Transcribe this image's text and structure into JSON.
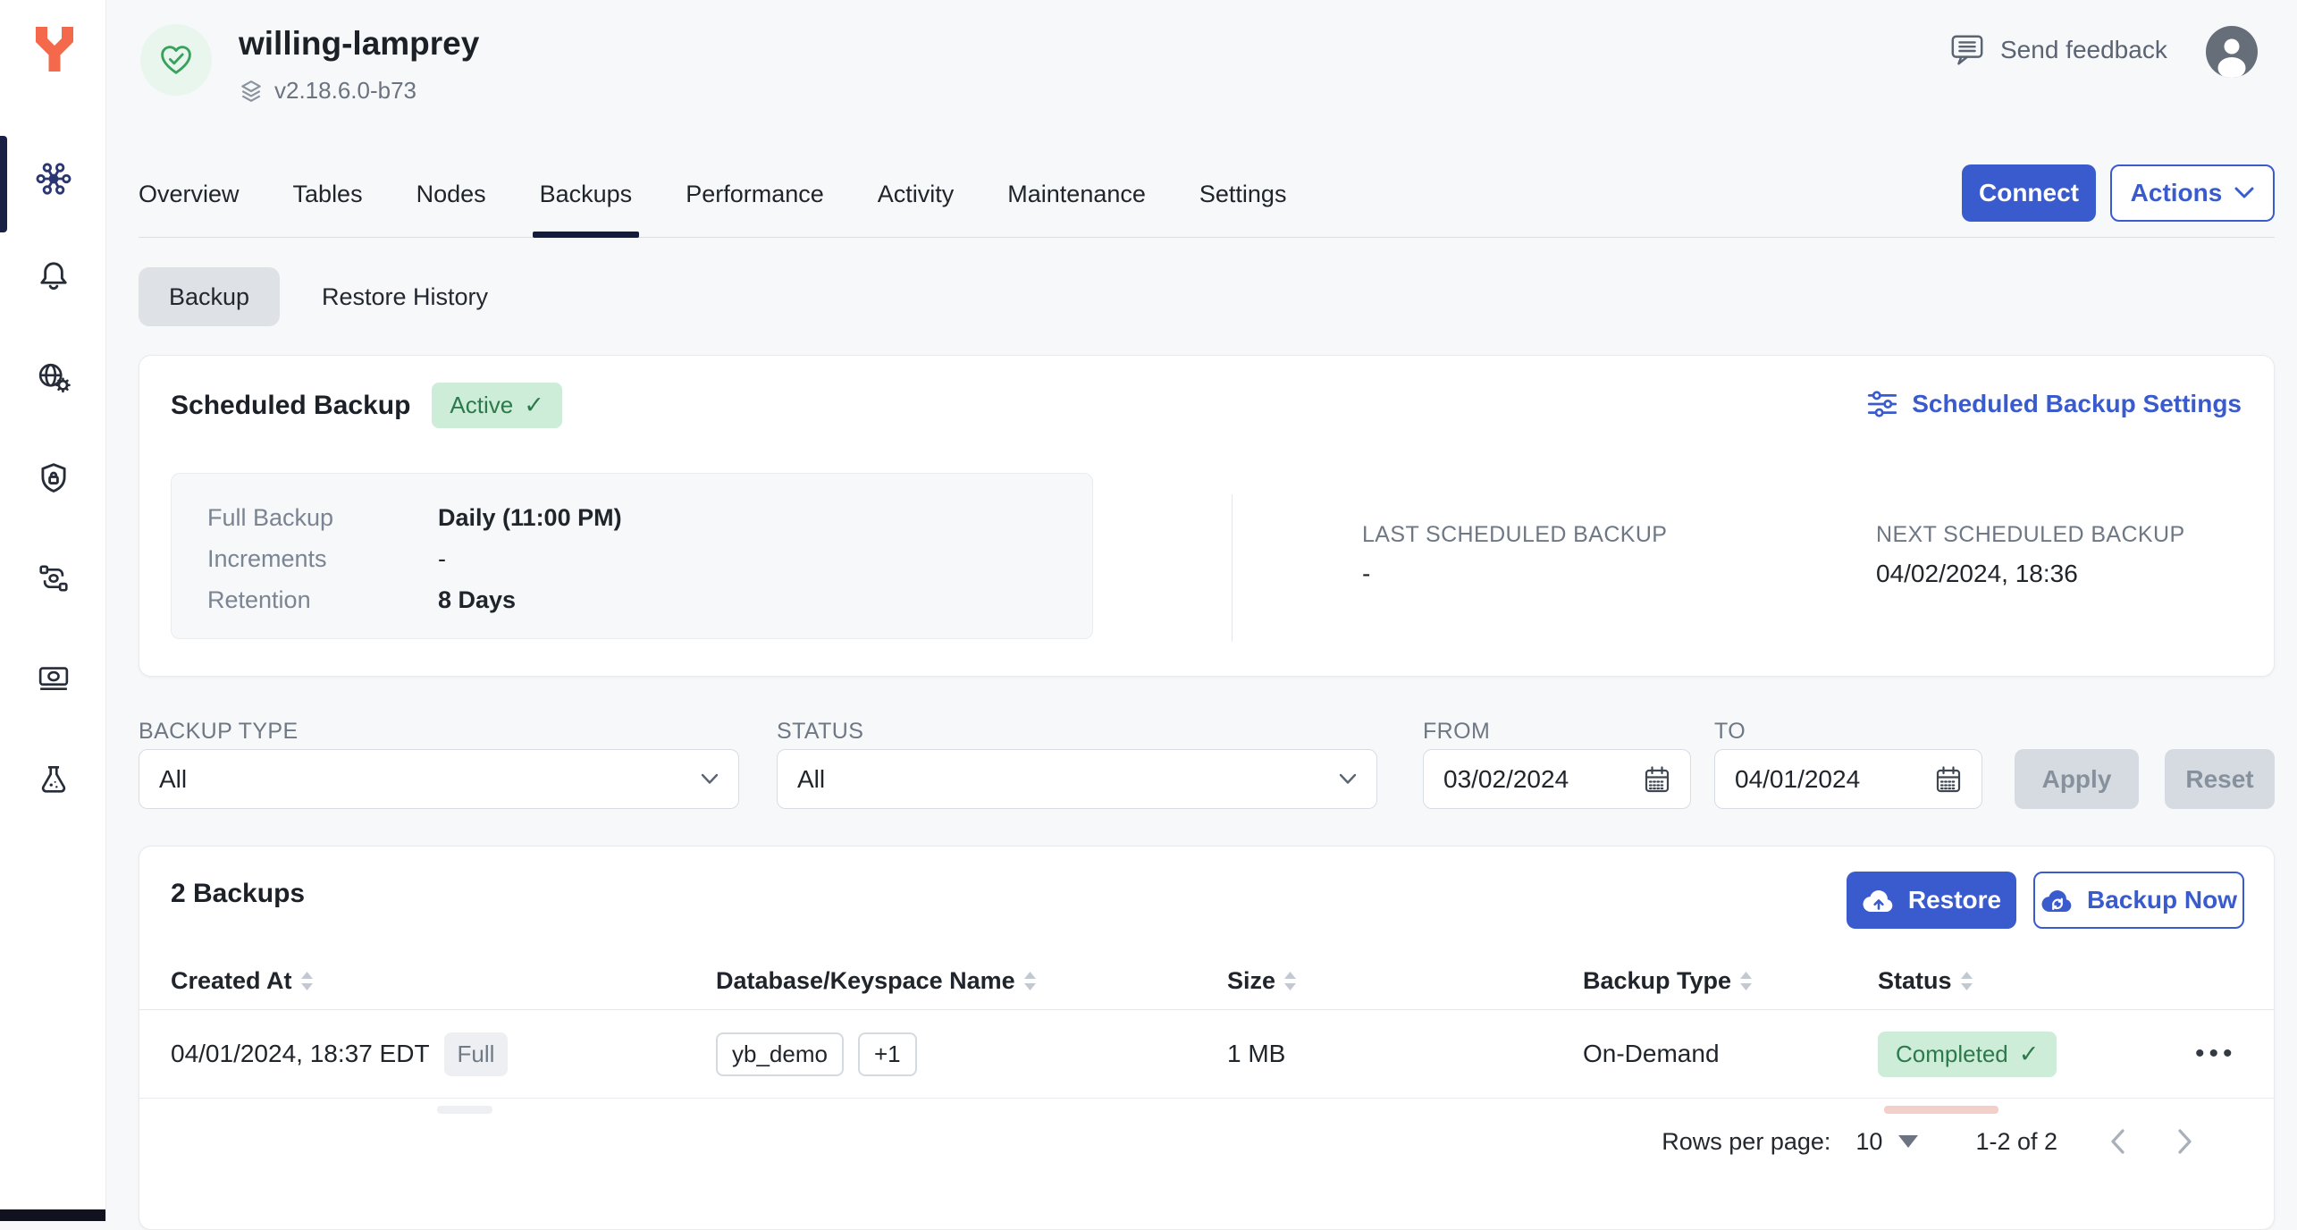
{
  "theme": {
    "accent_blue": "#3A5BCD",
    "navy": "#1A2145",
    "logo_orange": "#F4684C",
    "green_text": "#2C7A4B",
    "green_bg": "#CDEDD8",
    "page_bg": "#F7F8FA"
  },
  "sidebar": {
    "items": [
      {
        "icon": "clusters-hub-icon",
        "active": true
      },
      {
        "icon": "alerts-bell-icon",
        "active": false
      },
      {
        "icon": "network-globe-gear-icon",
        "active": false
      },
      {
        "icon": "security-shield-lock-icon",
        "active": false
      },
      {
        "icon": "integrations-flow-icon",
        "active": false
      },
      {
        "icon": "billing-money-icon",
        "active": false
      },
      {
        "icon": "labs-flask-icon",
        "active": false
      }
    ]
  },
  "header": {
    "cluster_name": "willing-lamprey",
    "version": "v2.18.6.0-b73",
    "send_feedback_label": "Send feedback",
    "health_icon": "heart-check-icon",
    "avatar_icon": "user-avatar-icon"
  },
  "tabs": {
    "items": [
      {
        "label": "Overview"
      },
      {
        "label": "Tables"
      },
      {
        "label": "Nodes"
      },
      {
        "label": "Backups"
      },
      {
        "label": "Performance"
      },
      {
        "label": "Activity"
      },
      {
        "label": "Maintenance"
      },
      {
        "label": "Settings"
      }
    ],
    "active": "Backups",
    "connect_label": "Connect",
    "actions_label": "Actions"
  },
  "subtabs": {
    "backup_label": "Backup",
    "restore_history_label": "Restore History",
    "active": "Backup"
  },
  "scheduled_backup": {
    "title": "Scheduled Backup",
    "status_badge": "Active",
    "settings_link": "Scheduled Backup Settings",
    "fields": [
      {
        "label": "Full Backup",
        "value": "Daily (11:00 PM)"
      },
      {
        "label": "Increments",
        "value": "-"
      },
      {
        "label": "Retention",
        "value": "8 Days"
      }
    ],
    "last_label": "LAST SCHEDULED BACKUP",
    "last_value": "-",
    "next_label": "NEXT SCHEDULED BACKUP",
    "next_value": "04/02/2024, 18:36"
  },
  "filters": {
    "backup_type_label": "BACKUP TYPE",
    "backup_type_value": "All",
    "status_label": "STATUS",
    "status_value": "All",
    "from_label": "FROM",
    "from_value": "03/02/2024",
    "to_label": "TO",
    "to_value": "04/01/2024",
    "apply_label": "Apply",
    "reset_label": "Reset"
  },
  "backups_table": {
    "title": "2 Backups",
    "restore_label": "Restore",
    "backup_now_label": "Backup Now",
    "columns": [
      {
        "label": "Created At"
      },
      {
        "label": "Database/Keyspace Name"
      },
      {
        "label": "Size"
      },
      {
        "label": "Backup Type"
      },
      {
        "label": "Status"
      }
    ],
    "rows": [
      {
        "created_at": "04/01/2024, 18:37 EDT",
        "type_badge": "Full",
        "keyspaces": [
          "yb_demo",
          "+1"
        ],
        "size": "1 MB",
        "backup_type": "On-Demand",
        "status": "Completed"
      }
    ],
    "pagination": {
      "rows_per_page_label": "Rows per page:",
      "rows_per_page_value": "10",
      "range_label": "1-2 of 2"
    }
  }
}
